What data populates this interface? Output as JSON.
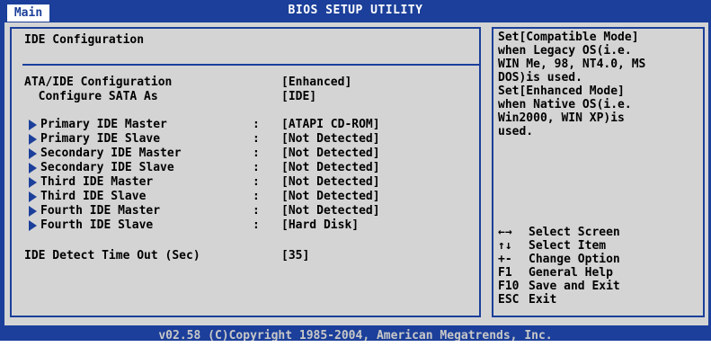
{
  "app_title": "BIOS SETUP UTILITY",
  "tab": "Main",
  "section_title": "IDE Configuration",
  "settings": [
    {
      "label": "ATA/IDE Configuration",
      "value": "[Enhanced]",
      "submenu": false
    },
    {
      "label": "  Configure SATA As",
      "value": "[IDE]",
      "submenu": false
    }
  ],
  "ide_devices": [
    {
      "label": "Primary IDE Master",
      "value": "[ATAPI CD-ROM]"
    },
    {
      "label": "Primary IDE Slave",
      "value": "[Not Detected]"
    },
    {
      "label": "Secondary IDE Master",
      "value": "[Not Detected]"
    },
    {
      "label": "Secondary IDE Slave",
      "value": "[Not Detected]"
    },
    {
      "label": "Third IDE Master",
      "value": "[Not Detected]"
    },
    {
      "label": "Third IDE Slave",
      "value": "[Not Detected]"
    },
    {
      "label": "Fourth IDE Master",
      "value": "[Not Detected]"
    },
    {
      "label": "Fourth IDE Slave",
      "value": "[Hard Disk]"
    }
  ],
  "separator": ":",
  "detect_timeout": {
    "label": "IDE Detect Time Out (Sec)",
    "value": "[35]"
  },
  "help_lines": [
    "Set[Compatible Mode]",
    "when Legacy OS(i.e.",
    "WIN Me, 98, NT4.0, MS",
    "DOS)is used.",
    "Set[Enhanced Mode]",
    "when Native OS(i.e.",
    "Win2000, WIN XP)is",
    "used."
  ],
  "keys": [
    {
      "symbol": "←→",
      "desc": "Select Screen"
    },
    {
      "symbol": "↑↓",
      "desc": "Select Item"
    },
    {
      "symbol": "+-",
      "desc": "Change Option"
    },
    {
      "symbol": "F1",
      "desc": "General Help"
    },
    {
      "symbol": "F10",
      "desc": "Save and Exit"
    },
    {
      "symbol": "ESC",
      "desc": "Exit"
    }
  ],
  "footer": "v02.58 (C)Copyright 1985-2004, American Megatrends, Inc.",
  "colors": {
    "frame_blue": "#1b3f9a",
    "panel_gray": "#d4d4d4",
    "text": "#000000"
  }
}
